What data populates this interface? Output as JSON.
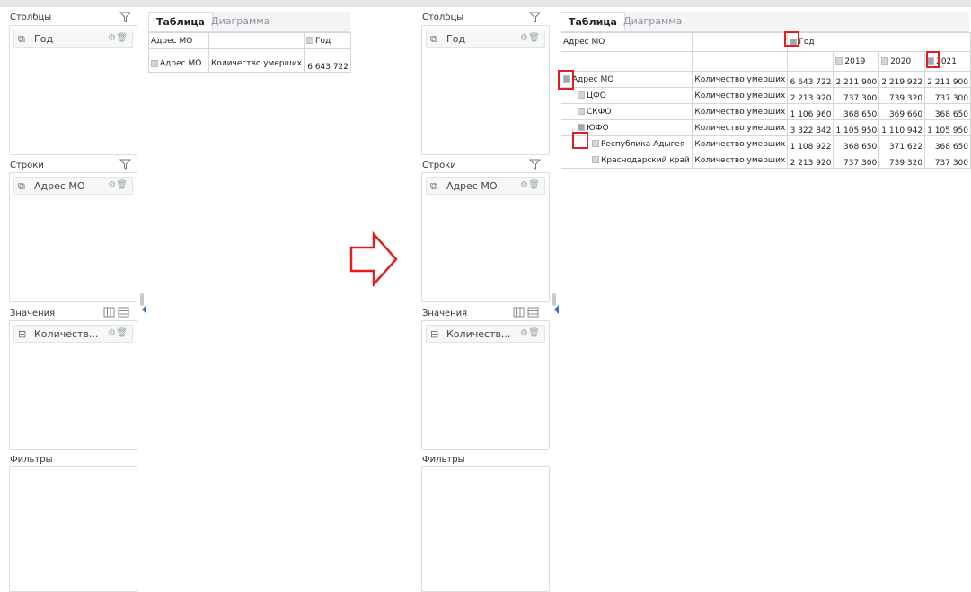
{
  "left": {
    "sections": {
      "columns": "Столбцы",
      "rows": "Строки",
      "values": "Значения",
      "filters": "Фильтры"
    },
    "fields": {
      "columns": "Год",
      "rows": "Адрес МО",
      "values": "Количеств..."
    },
    "tabs": [
      "Таблица",
      "Диаграмма"
    ],
    "table": {
      "h1": "Адрес МО",
      "h3": "Год",
      "r1": "Адрес МО",
      "r2": "Количество умерших",
      "r3": "6 643 722"
    }
  },
  "right": {
    "sections": {
      "columns": "Столбцы",
      "rows": "Строки",
      "values": "Значения",
      "filters": "Фильтры"
    },
    "fields": {
      "columns": "Год",
      "rows": "Адрес МО",
      "values": "Количеств..."
    },
    "tabs": [
      "Таблица",
      "Диаграмма"
    ],
    "table": {
      "head_addr": "Адрес МО",
      "head_year": "Год",
      "years": [
        "2019",
        "2020",
        "2021"
      ],
      "measure": "Количество умерших",
      "rows": [
        {
          "name": "Адрес МО",
          "total": "6 643 722",
          "v": [
            "2 211 900",
            "2 219 922",
            "2 211 900"
          ]
        },
        {
          "name": "ЦФО",
          "total": "2 213 920",
          "v": [
            "737 300",
            "739 320",
            "737 300"
          ]
        },
        {
          "name": "СКФО",
          "total": "1 106 960",
          "v": [
            "368 650",
            "369 660",
            "368 650"
          ]
        },
        {
          "name": "ЮФО",
          "total": "3 322 842",
          "v": [
            "1 105 950",
            "1 110 942",
            "1 105 950"
          ]
        },
        {
          "name": "Республика Адыгея",
          "total": "1 108 922",
          "v": [
            "368 650",
            "371 622",
            "368 650"
          ]
        },
        {
          "name": "Краснодарский край",
          "total": "2 213 920",
          "v": [
            "737 300",
            "739 320",
            "737 300"
          ]
        }
      ]
    }
  },
  "colors": {
    "highlight": "#e02020",
    "accent": "#3b6fbf"
  },
  "icons": {
    "filter": "filter-icon",
    "gear": "gear-icon",
    "trash": "trash-icon",
    "arrow": "right-arrow-outline"
  }
}
